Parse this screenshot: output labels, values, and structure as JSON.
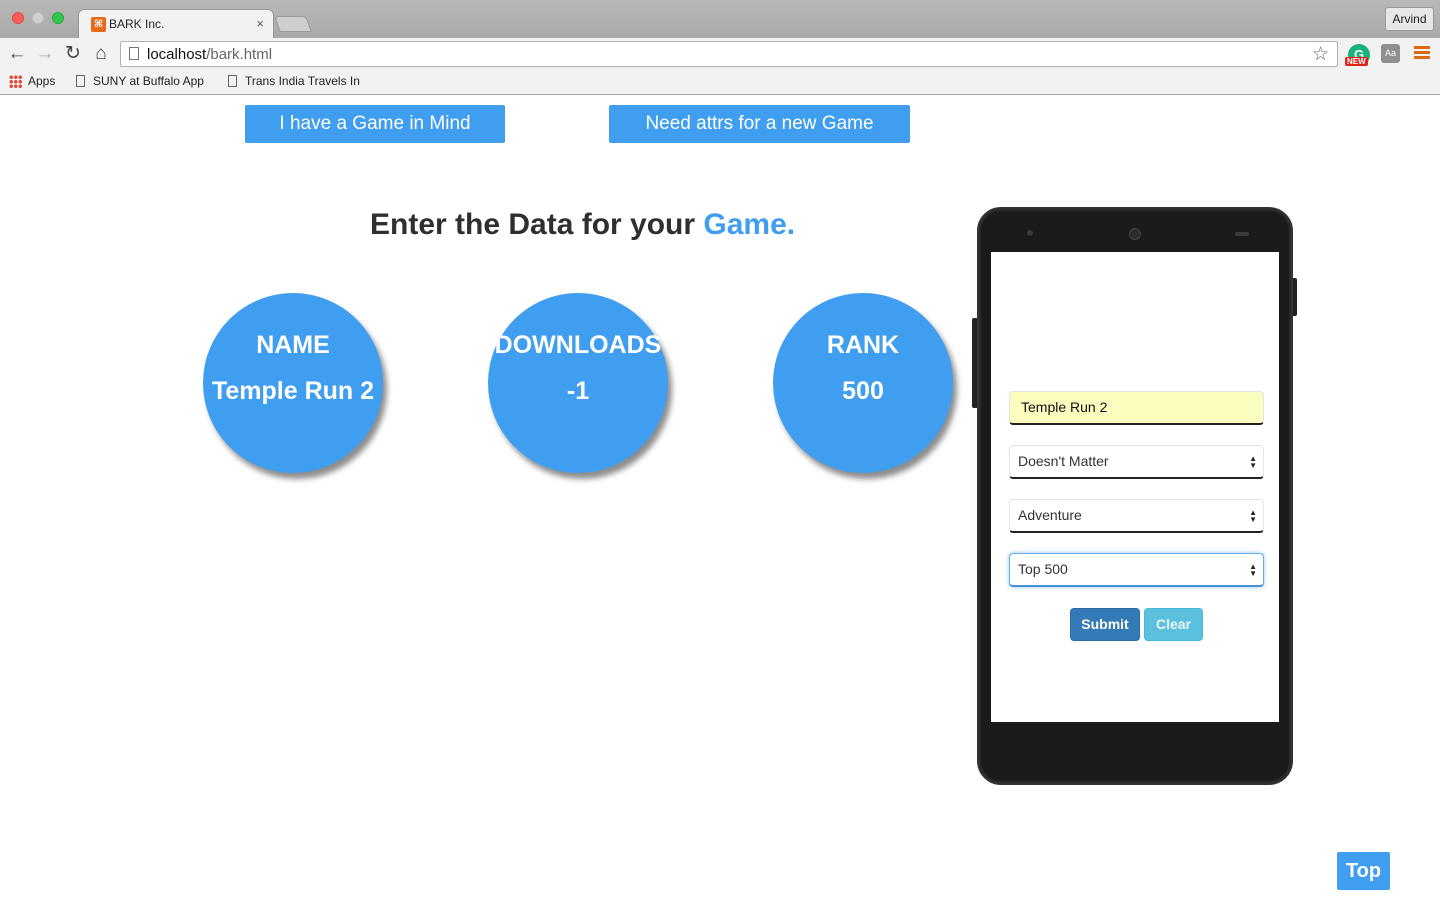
{
  "browser": {
    "tab_title": "BARK Inc.",
    "tab_close": "×",
    "profile_name": "Arvind",
    "url_host": "localhost",
    "url_path": "/bark.html",
    "bookmarks": {
      "apps": "Apps",
      "item1": "SUNY at Buffalo App",
      "item2": "Trans India Travels In"
    },
    "icons": {
      "back": "arrow-left-icon",
      "forward": "arrow-right-icon",
      "reload": "reload-icon",
      "home": "home-icon",
      "bookmark_star": "star-icon"
    },
    "extension_badge": "NEW"
  },
  "nav": {
    "game_in_mind": "I have a Game in Mind",
    "new_game_attrs": "Need attrs for a new Game"
  },
  "heading": {
    "prefix": "Enter the Data for your ",
    "accent": "Game."
  },
  "circles": {
    "name": {
      "label": "NAME",
      "value": "Temple Run 2"
    },
    "downloads": {
      "label": "DOWNLOADS",
      "value": "-1"
    },
    "rank": {
      "label": "RANK",
      "value": "500"
    }
  },
  "form": {
    "name_value": "Temple Run 2",
    "select_downloads": "Doesn't Matter",
    "select_genre": "Adventure",
    "select_rank": "Top 500",
    "submit_label": "Submit",
    "clear_label": "Clear"
  },
  "footer": {
    "top_label": "Top"
  },
  "colors": {
    "accent": "#409ef0",
    "submit": "#337ab7",
    "clear": "#5bc0de",
    "autofill": "#fafdbe"
  }
}
